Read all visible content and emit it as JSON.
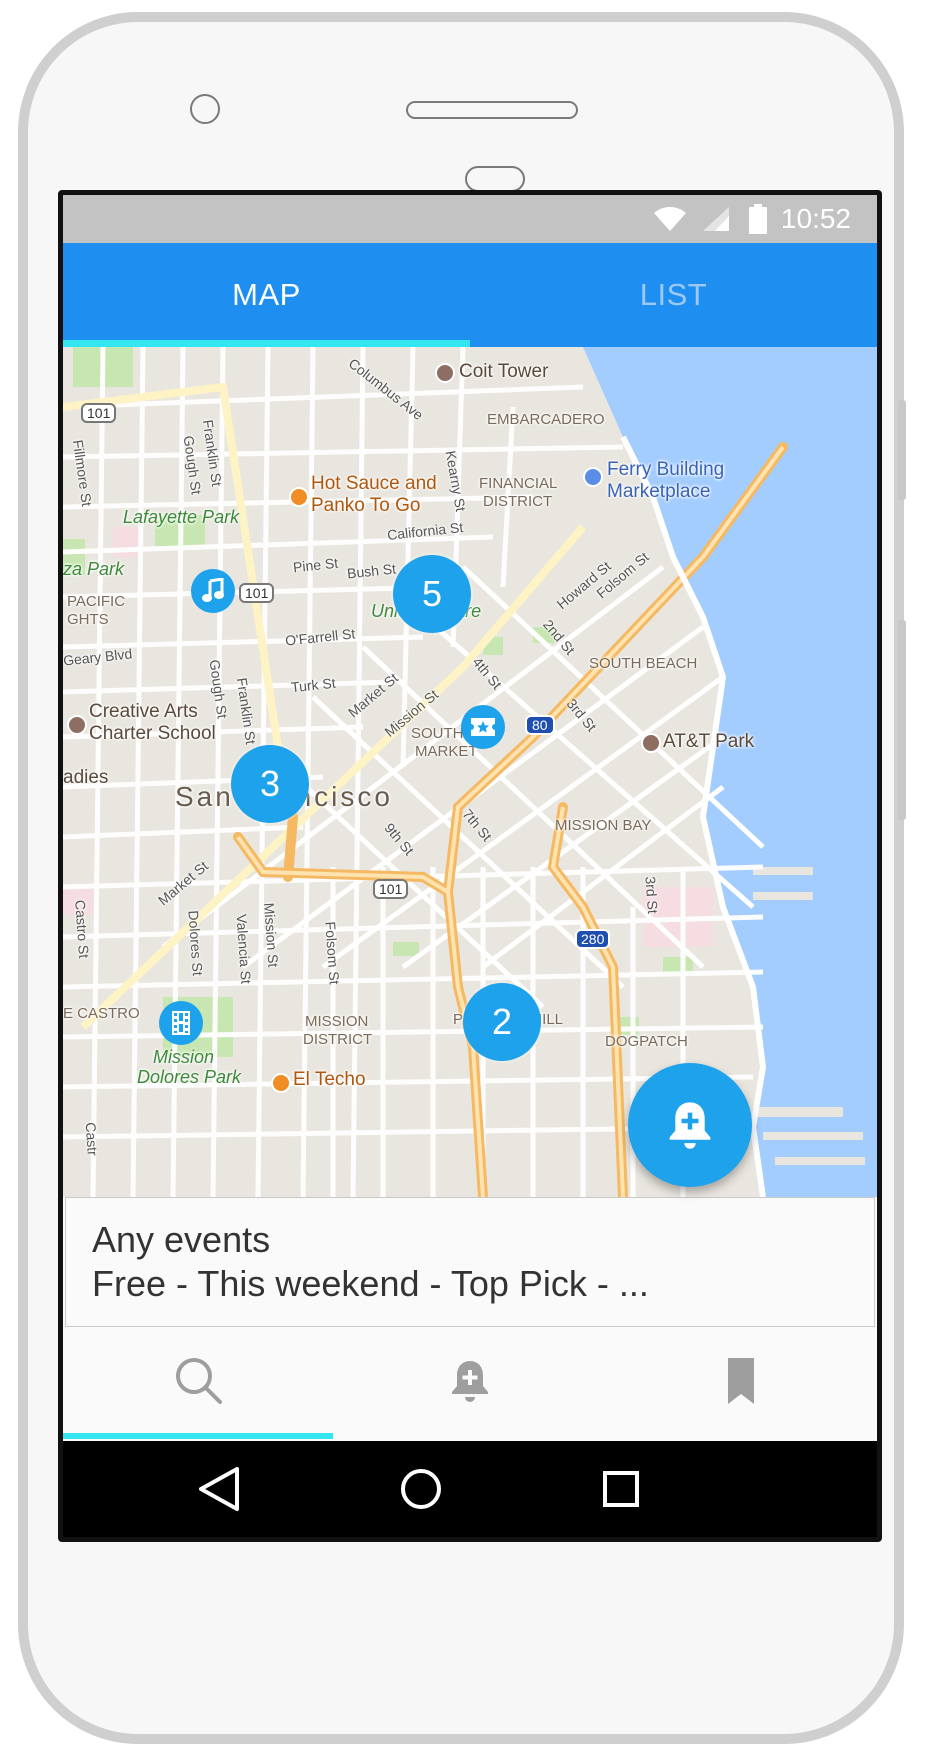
{
  "status_bar": {
    "time": "10:52"
  },
  "tabs": [
    {
      "label": "MAP",
      "active": true
    },
    {
      "label": "LIST",
      "active": false
    }
  ],
  "map": {
    "labels": {
      "coit_tower": "Coit Tower",
      "embarcadero": "EMBARCADERO",
      "ferry_building_1": "Ferry Building",
      "ferry_building_2": "Marketplace",
      "hot_sauce_1": "Hot Sauce and",
      "hot_sauce_2": "Panko To Go",
      "financial_1": "FINANCIAL",
      "financial_2": "DISTRICT",
      "lafayette_park": "Lafayette Park",
      "plaza_park": "za Park",
      "pacific_1": "PACIFIC",
      "pacific_2": "GHTS",
      "union_square": "Union Square",
      "south_beach": "SOUTH BEACH",
      "creative_arts_1": "Creative Arts",
      "creative_arts_2": "Charter School",
      "att_park": "AT&T Park",
      "south_market_1": "SOUTH",
      "south_market_2": "MARKET",
      "ladies": "adies",
      "san_francisco": "San Francisco",
      "mission_bay": "MISSION BAY",
      "castro": "E CASTRO",
      "mission_district_1": "MISSION",
      "mission_district_2": "DISTRICT",
      "potrero_hill": "POTRERO HILL",
      "dogpatch": "DOGPATCH",
      "mission_dolores_1": "Mission",
      "mission_dolores_2": "Dolores Park",
      "el_techo": "El Techo",
      "hwy_101_a": "101",
      "hwy_101_b": "101",
      "hwy_101_c": "101",
      "hwy_80": "80",
      "hwy_280": "280",
      "st_columbus": "Columbus Ave",
      "st_kearny": "Kearny St",
      "st_california": "California St",
      "st_pine": "Pine St",
      "st_bush": "Bush St",
      "st_ofarrell": "O'Farrell St",
      "st_turk": "Turk St",
      "st_geary": "Geary Blvd",
      "st_franklin": "Franklin St",
      "st_franklin2": "Franklin St",
      "st_gough": "Gough St",
      "st_gough2": "Gough St",
      "st_fillmore": "Fillmore St",
      "st_market": "Market St",
      "st_market2": "Market St",
      "st_mission": "Mission St",
      "st_mission2": "Mission St",
      "st_4th": "4th St",
      "st_2nd": "2nd St",
      "st_howard": "Howard St",
      "st_folsom": "Folsom St",
      "st_folsom2": "Folsom St",
      "st_3rd": "3rd St",
      "st_3rd2": "3rd St",
      "st_9th": "9th St",
      "st_7th": "7th St",
      "st_castro": "Castro St",
      "st_castro2": "Castr",
      "st_dolores": "Dolores St",
      "st_valencia": "Valencia St"
    },
    "clusters": [
      {
        "id": "union-square-cluster",
        "count": "5"
      },
      {
        "id": "civic-center-cluster",
        "count": "3"
      },
      {
        "id": "potrero-cluster",
        "count": "2"
      }
    ],
    "event_markers": [
      "music-icon",
      "ticket-star-icon",
      "film-icon"
    ]
  },
  "filter": {
    "title": "Any events",
    "summary": "Free - This weekend - Top Pick - ..."
  },
  "fab_icon": "add-alert-icon",
  "bottom_nav": [
    "search-icon",
    "add-alert-icon",
    "bookmark-icon"
  ],
  "system_nav": [
    "back-icon",
    "home-icon",
    "recents-icon"
  ],
  "colors": {
    "app_bar": "#1e8ff0",
    "tab_indicator": "#33e6f0",
    "marker": "#1ea2ec",
    "water": "#a3ccff"
  }
}
